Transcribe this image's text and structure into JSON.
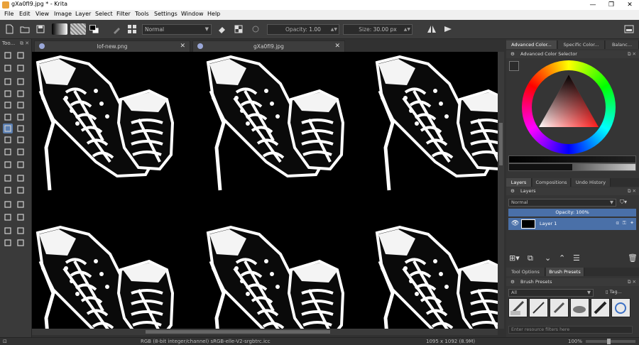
{
  "window": {
    "title": "gXa0fI9.jpg * - Krita",
    "minimize": "—",
    "maximize": "❐",
    "close": "✕"
  },
  "menu": [
    "File",
    "Edit",
    "View",
    "Image",
    "Layer",
    "Select",
    "Filter",
    "Tools",
    "Settings",
    "Window",
    "Help"
  ],
  "toolbar": {
    "blend_mode": "Normal",
    "opacity_label": "Opacity:",
    "opacity_value": "1.00",
    "size_label": "Size:",
    "size_value": "30.00 px"
  },
  "toolbox": {
    "title": "Too...",
    "buttons": "⧉ ✕"
  },
  "documents": {
    "tabs": [
      {
        "name": "lof-new.png",
        "close": "✕"
      },
      {
        "name": "gXa0fI9.jpg",
        "close": "✕"
      }
    ]
  },
  "dock": {
    "color_tabs": [
      "Advanced Color...",
      "Specific Color...",
      "Balanc..."
    ],
    "color_panel_title": "Advanced Color Selector",
    "layer_tabs": [
      "Layers",
      "Compositions",
      "Undo History"
    ],
    "layers_panel_title": "Layers",
    "layer_blend": "Normal",
    "layer_opacity": "Opacity: 100%",
    "layer_name": "Layer 1",
    "preset_tabs": [
      "Tool Options",
      "Brush Presets"
    ],
    "presets_panel_title": "Brush Presets",
    "preset_filter": "All",
    "tag_label": "Tag...",
    "preset_search_placeholder": "Enter resource filters here",
    "float_close": "⧉ ✕"
  },
  "status": {
    "color_space": "RGB (8-bit integer/channel)  sRGB-elle-V2-srgbtrc.icc",
    "dimensions": "1095 x 1092 (8.9M)",
    "zoom": "100%"
  },
  "colors": {
    "accent": "#4a70a8",
    "background": "#313131"
  }
}
